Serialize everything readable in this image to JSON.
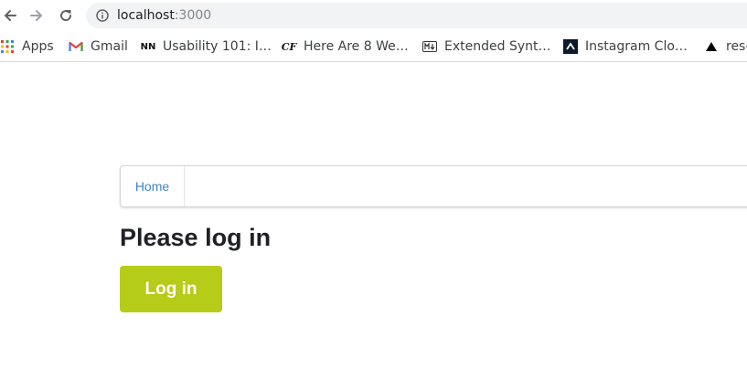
{
  "browser": {
    "url_host": "localhost",
    "url_port": ":3000",
    "back_icon": "arrow-left-icon",
    "forward_icon": "arrow-right-icon",
    "reload_icon": "reload-icon",
    "info_icon": "info-icon"
  },
  "bookmarks": [
    {
      "label": "Apps",
      "icon": "apps-grid-icon"
    },
    {
      "label": "Gmail",
      "icon": "gmail-icon"
    },
    {
      "label": "Usability 101: I…",
      "icon": "nn-icon"
    },
    {
      "label": "Here Are 8 We…",
      "icon": "cf-icon"
    },
    {
      "label": "Extended Synt…",
      "icon": "markdown-icon"
    },
    {
      "label": "Instagram Clo…",
      "icon": "caret-icon"
    },
    {
      "label": "res-",
      "icon": "triangle-icon"
    }
  ],
  "page": {
    "nav": {
      "home_label": "Home"
    },
    "heading": "Please log in",
    "login_button": "Log in",
    "colors": {
      "login_button": "#b5cc18",
      "link": "#4183c4"
    }
  }
}
